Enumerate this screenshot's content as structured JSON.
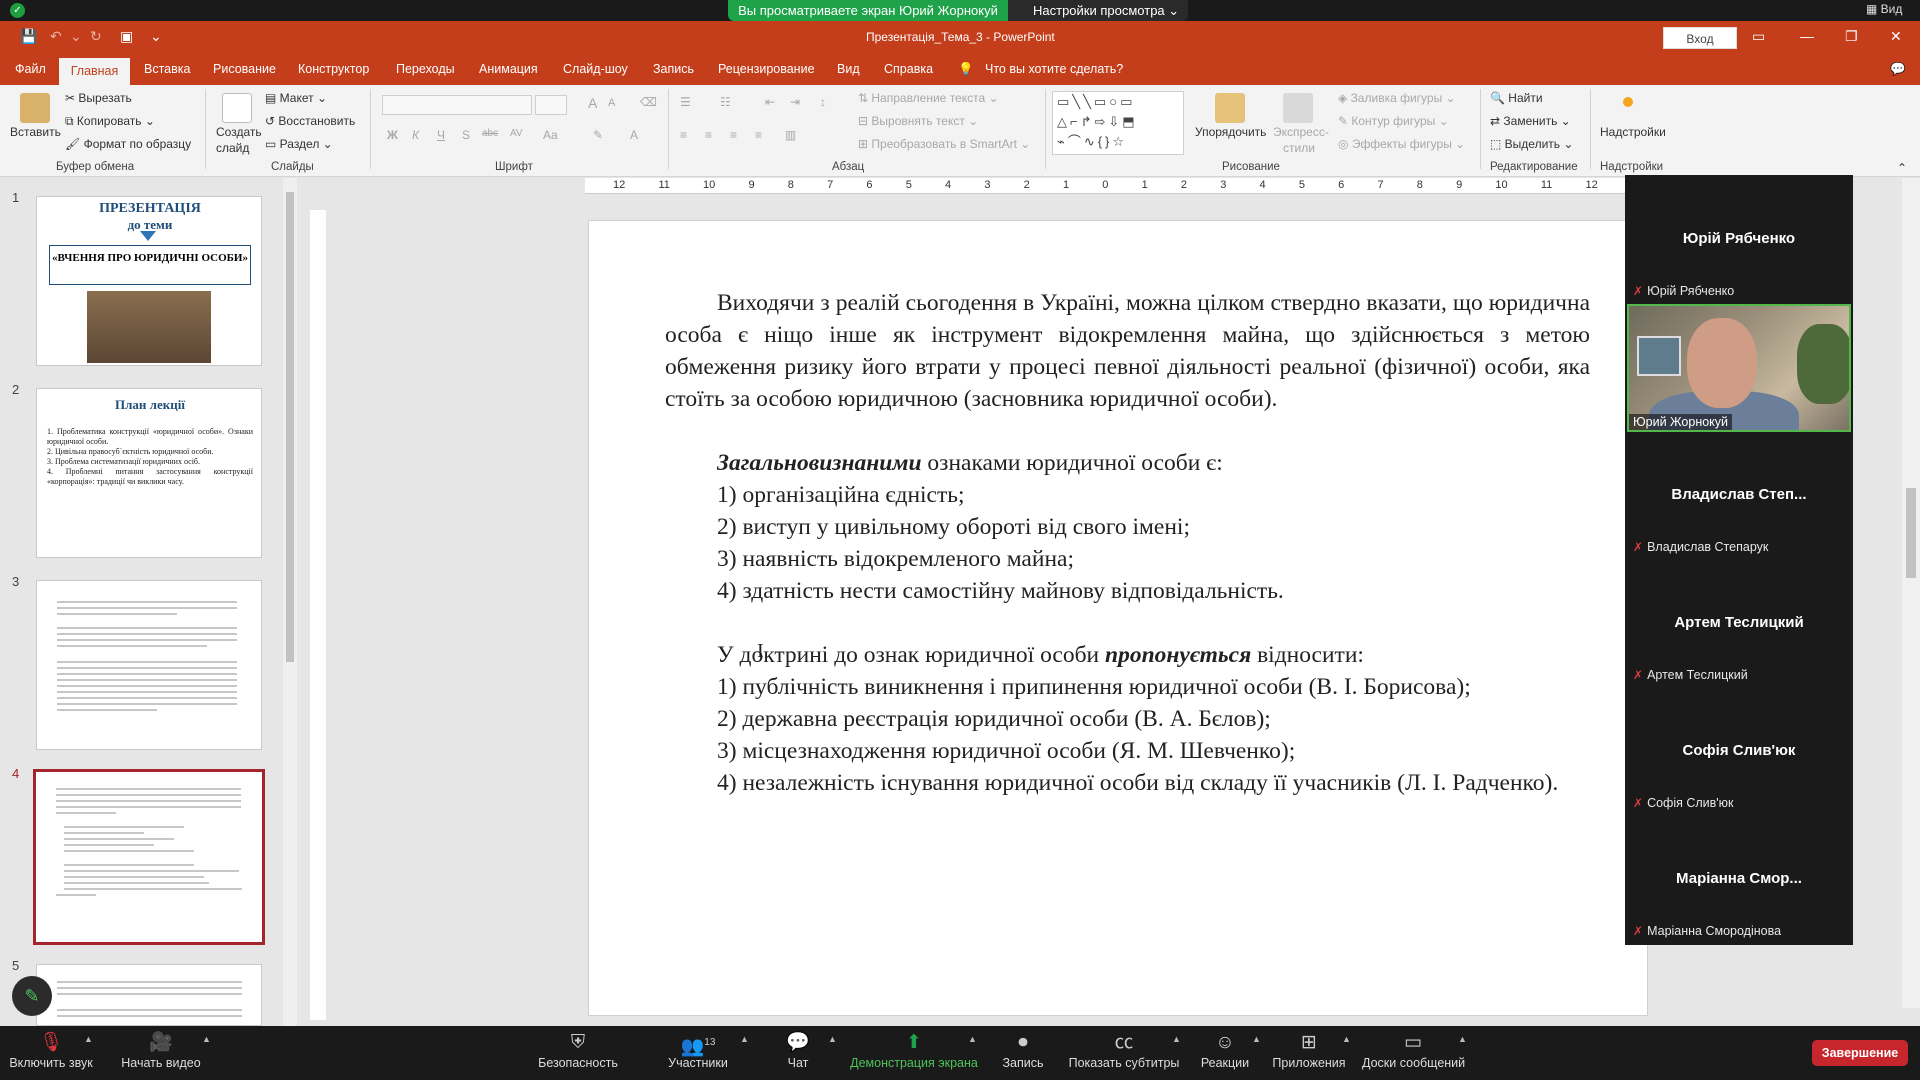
{
  "zoom": {
    "viewing_banner": "Вы просматриваете экран Юрий Жорнокуй",
    "view_settings": "Настройки просмотра",
    "view_label": "Вид"
  },
  "titlebar": {
    "title": "Презентація_Тема_3  -  PowerPoint",
    "signin": "Вход"
  },
  "tabs": [
    "Файл",
    "Главная",
    "Вставка",
    "Рисование",
    "Конструктор",
    "Переходы",
    "Анимация",
    "Слайд-шоу",
    "Запись",
    "Рецензирование",
    "Вид",
    "Справка"
  ],
  "tell_me": "Что вы хотите сделать?",
  "ribbon": {
    "paste": "Вставить",
    "cut": "Вырезать",
    "copy": "Копировать",
    "format_painter": "Формат по образцу",
    "clipboard": "Буфер обмена",
    "new_slide_1": "Создать",
    "new_slide_2": "слайд",
    "layout": "Макет",
    "reset": "Восстановить",
    "section": "Раздел",
    "slides": "Слайды",
    "font": "Шрифт",
    "text_direction": "Направление текста",
    "align_text": "Выровнять текст",
    "smartart": "Преобразовать в SmartArt",
    "paragraph": "Абзац",
    "arrange": "Упорядочить",
    "quick_styles_1": "Экспресс-",
    "quick_styles_2": "стили",
    "shape_fill": "Заливка фигуры",
    "shape_outline": "Контур фигуры",
    "shape_effects": "Эффекты фигуры",
    "drawing": "Рисование",
    "find": "Найти",
    "replace": "Заменить",
    "select": "Выделить",
    "editing": "Редактирование",
    "addins": "Надстройки",
    "addins_group": "Надстройки",
    "font_size_buttons": [
      "A",
      "A"
    ],
    "format_buttons": [
      "Ж",
      "К",
      "Ч",
      "S",
      "abc",
      "AV",
      "Aa"
    ]
  },
  "ruler": [
    "12",
    "11",
    "10",
    "9",
    "8",
    "7",
    "6",
    "5",
    "4",
    "3",
    "2",
    "1",
    "0",
    "1",
    "2",
    "3",
    "4",
    "5",
    "6",
    "7",
    "8",
    "9",
    "10",
    "11",
    "12"
  ],
  "thumbs": {
    "numbers": [
      "1",
      "2",
      "3",
      "4",
      "5"
    ],
    "t1_title": "ПРЕЗЕНТАЦІЯ",
    "t1_sub": "до теми",
    "t1_box": "«ВЧЕННЯ ПРО ЮРИДИЧНІ ОСОБИ»",
    "t2_title": "План лекції",
    "t2_items": [
      "1. Проблематика конструкції «юридичної особи». Ознаки юридичної особи.",
      "2. Цивільна правосуб`єктність юридичної особи.",
      "3. Проблема систематизації юридичних осіб.",
      "4. Проблемні питання застосування конструкції «корпорація»: традиції чи виклики часу."
    ]
  },
  "slide": {
    "p1": "Виходячи з реалій сьогодення в Україні, можна цілком ствердно вказати, що юридична особа є ніщо інше як інструмент відокремлення майна, що здійснюється з метою обмеження ризику його втрати у процесі певної діяльності реальної (фізичної) особи, яка стоїть за особою юридичною (засновника юридичної особи).",
    "p2_em": "Загальновизнаними",
    "p2_rest": " ознаками юридичної особи є:",
    "list1": [
      "1) організаційна єдність;",
      "2) виступ у цивільному обороті від свого імені;",
      "3) наявність відокремленого майна;",
      "4) здатність нести самостійну майнову відповідальність."
    ],
    "p3_a": "У доктрині до ознак юридичної особи ",
    "p3_em": "пропонується",
    "p3_b": " відносити:",
    "list2": [
      "1) публічність виникнення і припинення юридичної особи (В. І. Борисова);",
      "2) державна реєстрація юридичної особи (В. А. Бєлов);",
      "3) місцезнаходження юридичної особи (Я. М. Шевченко);"
    ],
    "p4": "4) незалежність існування юридичної особи від складу її учасників (Л. І. Радченко)."
  },
  "participants": [
    {
      "title": "Юрій Рябченко",
      "label": "Юрій Рябченко"
    },
    {
      "title": "Владислав  Степ...",
      "label": "Владислав Степарук"
    },
    {
      "title": "Артем Теслицкий",
      "label": "Артем Теслицкий"
    },
    {
      "title": "Софія Слив'юк",
      "label": "Софія Слив'юк"
    },
    {
      "title": "Маріанна  Смор...",
      "label": "Маріанна Смородінова"
    }
  ],
  "video_name": "Юрий Жорнокуй",
  "zoom_bottom": {
    "mute": "Включить звук",
    "video": "Начать видео",
    "security": "Безопасность",
    "participants": "Участники",
    "participants_count": "13",
    "chat": "Чат",
    "share": "Демонстрация экрана",
    "record": "Запись",
    "captions": "Показать субтитры",
    "reactions": "Реакции",
    "apps": "Приложения",
    "whiteboards": "Доски сообщений",
    "end": "Завершение"
  },
  "colors": {
    "accent": "#c43e1c",
    "zoom_green": "#1fa34a",
    "end_red": "#c6262c",
    "selection": "#a4262c"
  }
}
